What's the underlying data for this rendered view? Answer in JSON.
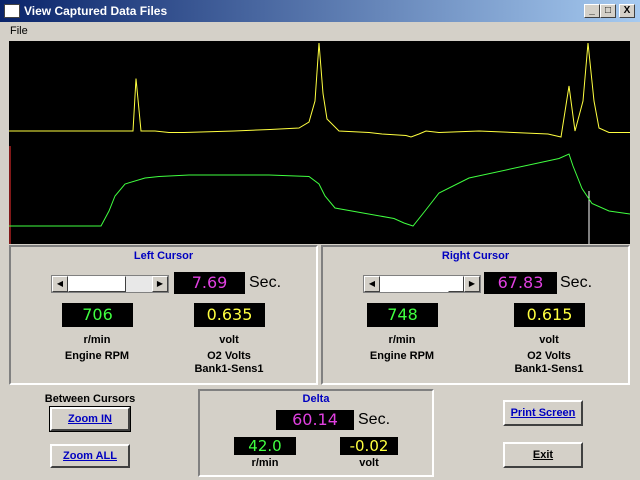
{
  "window": {
    "title": "View Captured Data Files"
  },
  "menu": {
    "file": "File"
  },
  "buttons_titlebar": {
    "minimize": "_",
    "maximize": "□",
    "close": "X"
  },
  "chart_data": {
    "type": "line",
    "title": "",
    "series": [
      {
        "color": "#ffff40",
        "x": [
          0,
          20,
          99,
          104,
          110,
          116,
          124,
          127,
          132,
          146,
          160,
          175,
          225,
          261,
          290,
          300,
          306,
          310,
          314,
          318,
          330,
          360,
          373,
          397,
          402,
          410,
          417,
          430,
          470,
          539,
          552,
          560,
          566,
          574,
          579,
          585,
          590,
          600,
          621
        ],
        "y": [
          0.1,
          0.1,
          0.1,
          0.1,
          0.1,
          0.1,
          0.1,
          0.45,
          0.1,
          0.1,
          0.09,
          0.09,
          0.1,
          0.11,
          0.12,
          0.16,
          0.3,
          0.85,
          0.35,
          0.18,
          0.1,
          0.09,
          0.08,
          0.07,
          0.06,
          0.08,
          0.1,
          0.09,
          0.1,
          0.08,
          0.06,
          0.4,
          0.1,
          0.3,
          0.9,
          0.3,
          0.12,
          0.09,
          0.09
        ]
      },
      {
        "color": "#40ff40",
        "x": [
          0,
          82,
          92,
          100,
          106,
          116,
          136,
          150,
          180,
          260,
          300,
          310,
          316,
          326,
          385,
          395,
          404,
          416,
          430,
          460,
          550,
          560,
          564,
          573,
          583,
          600,
          621
        ],
        "y": [
          0.0,
          0.0,
          0.0,
          0.1,
          0.2,
          0.28,
          0.32,
          0.33,
          0.34,
          0.34,
          0.33,
          0.28,
          0.2,
          0.12,
          0.05,
          0.02,
          0.0,
          0.1,
          0.22,
          0.32,
          0.45,
          0.48,
          0.4,
          0.25,
          0.15,
          0.1,
          0.08
        ]
      }
    ]
  },
  "left_cursor": {
    "title": "Left Cursor",
    "time": "7.69",
    "time_unit": "Sec.",
    "ch1_value": "706",
    "ch1_unit": "r/min",
    "ch1_name": "Engine RPM",
    "ch2_value": "0.635",
    "ch2_unit": "volt",
    "ch2_name_1": "O2 Volts",
    "ch2_name_2": "Bank1-Sens1"
  },
  "right_cursor": {
    "title": "Right Cursor",
    "time": "67.83",
    "time_unit": "Sec.",
    "ch1_value": "748",
    "ch1_unit": "r/min",
    "ch1_name": "Engine RPM",
    "ch2_value": "0.615",
    "ch2_unit": "volt",
    "ch2_name_1": "O2 Volts",
    "ch2_name_2": "Bank1-Sens1"
  },
  "delta": {
    "title": "Delta",
    "time": "60.14",
    "time_unit": "Sec.",
    "ch1_value": "42.0",
    "ch1_unit": "r/min",
    "ch2_value": "-0.02",
    "ch2_unit": "volt"
  },
  "controls": {
    "between_cursors": "Between Cursors",
    "zoom_in": "Zoom IN",
    "zoom_all": "Zoom ALL",
    "print_screen": "Print Screen",
    "exit": "Exit"
  }
}
